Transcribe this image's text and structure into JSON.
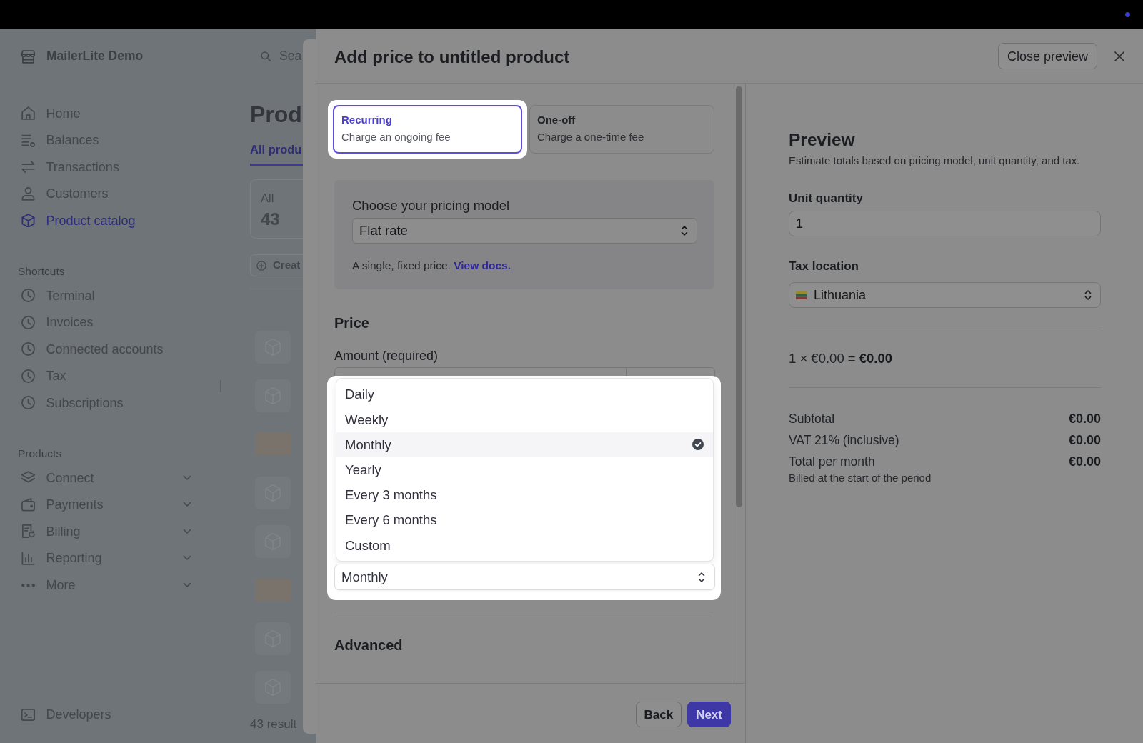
{
  "sidebar": {
    "account_name": "MailerLite Demo",
    "nav": [
      {
        "label": "Home",
        "selected": false
      },
      {
        "label": "Balances",
        "selected": false
      },
      {
        "label": "Transactions",
        "selected": false
      },
      {
        "label": "Customers",
        "selected": false
      },
      {
        "label": "Product catalog",
        "selected": true
      }
    ],
    "sections": [
      {
        "title": "Shortcuts",
        "items": [
          {
            "label": "Terminal",
            "selected": false
          },
          {
            "label": "Invoices",
            "selected": false
          },
          {
            "label": "Connected accounts",
            "selected": false
          },
          {
            "label": "Tax",
            "selected": false
          },
          {
            "label": "Subscriptions",
            "selected": false
          }
        ]
      },
      {
        "title": "Products",
        "items": [
          {
            "label": "Connect",
            "selected": false,
            "expanded": false
          },
          {
            "label": "Payments",
            "selected": false,
            "expanded": false
          },
          {
            "label": "Billing",
            "selected": false,
            "expanded": false
          },
          {
            "label": "Reporting",
            "selected": false,
            "expanded": false
          },
          {
            "label": "More",
            "selected": false,
            "expanded": false
          }
        ]
      }
    ],
    "footer_item": {
      "label": "Developers",
      "selected": false
    }
  },
  "background_page": {
    "search": {
      "placeholder": "Sea"
    },
    "heading": "Prod",
    "tabs": [
      {
        "label": "All produ",
        "selected": true
      }
    ],
    "summary_card": {
      "label": "All",
      "count": "43"
    },
    "create_button": "Creat",
    "rows": [
      {
        "kind": "icon"
      },
      {
        "kind": "icon"
      },
      {
        "kind": "photo"
      },
      {
        "kind": "icon"
      },
      {
        "kind": "icon"
      },
      {
        "kind": "photo"
      },
      {
        "kind": "icon"
      },
      {
        "kind": "icon"
      }
    ],
    "result_count": "43 result"
  },
  "dialog": {
    "title": "Add price to untitled product",
    "close_preview_button": "Close preview",
    "form": {
      "price_types": [
        {
          "title": "Recurring",
          "description": "Charge an ongoing fee",
          "selected": true
        },
        {
          "title": "One-off",
          "description": "Charge a one-time fee",
          "selected": false
        }
      ],
      "pricing_model": {
        "label": "Choose your pricing model",
        "value": "Flat rate",
        "help": "A single, fixed price.",
        "help_link": "View docs."
      },
      "price": {
        "heading": "Price",
        "amount_label": "Amount (required)",
        "billing_period": {
          "value": "Monthly",
          "expanded": true,
          "options": [
            {
              "label": "Daily",
              "selected": false
            },
            {
              "label": "Weekly",
              "selected": false
            },
            {
              "label": "Monthly",
              "selected": true
            },
            {
              "label": "Yearly",
              "selected": false
            },
            {
              "label": "Every 3 months",
              "selected": false
            },
            {
              "label": "Every 6 months",
              "selected": false
            },
            {
              "label": "Custom",
              "selected": false
            }
          ]
        }
      },
      "advanced": {
        "heading": "Advanced"
      },
      "footer": {
        "back_button": "Back",
        "next_button": "Next"
      }
    },
    "preview": {
      "title": "Preview",
      "subtitle": "Estimate totals based on pricing model, unit quantity, and tax.",
      "unit_quantity": {
        "label": "Unit quantity",
        "value": "1"
      },
      "tax_location": {
        "label": "Tax location",
        "value": "Lithuania"
      },
      "calculation": "1 × €0.00 = **€0.00**",
      "totals": [
        {
          "label": "Subtotal",
          "value": "€0.00"
        },
        {
          "label": "VAT 21% (inclusive)",
          "value": "€0.00"
        },
        {
          "label": "Total per month",
          "value": "€0.00",
          "note": "Billed at the start of the period"
        }
      ]
    }
  }
}
